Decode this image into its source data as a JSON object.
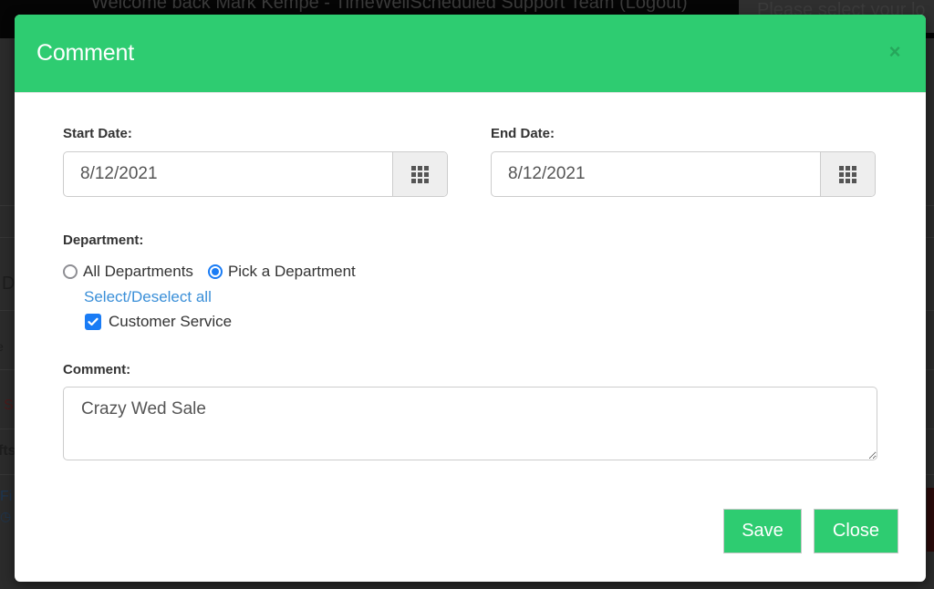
{
  "background": {
    "welcome_text": "Welcome back Mark Kempe - TimeWellScheduled Support Team (Logout)",
    "location_select_text": "Please select your lo",
    "left_fragments": [
      "D",
      "e",
      "S",
      "fts",
      "Fi",
      "◷ 3"
    ]
  },
  "modal": {
    "title": "Comment",
    "close_icon": "×",
    "start_date": {
      "label": "Start Date:",
      "value": "8/12/2021",
      "icon": "calendar-grid-icon"
    },
    "end_date": {
      "label": "End Date:",
      "value": "8/12/2021",
      "icon": "calendar-grid-icon"
    },
    "department": {
      "label": "Department:",
      "options": [
        {
          "label": "All Departments",
          "checked": false
        },
        {
          "label": "Pick a Department",
          "checked": true
        }
      ],
      "select_all_link": "Select/Deselect all",
      "departments": [
        {
          "label": "Customer Service",
          "checked": true
        }
      ]
    },
    "comment": {
      "label": "Comment:",
      "value": "Crazy Wed Sale"
    },
    "buttons": {
      "save": "Save",
      "close": "Close"
    }
  },
  "colors": {
    "header_green": "#2ecc71",
    "link_blue": "#3a8fd8",
    "control_blue": "#1a7cf5"
  }
}
